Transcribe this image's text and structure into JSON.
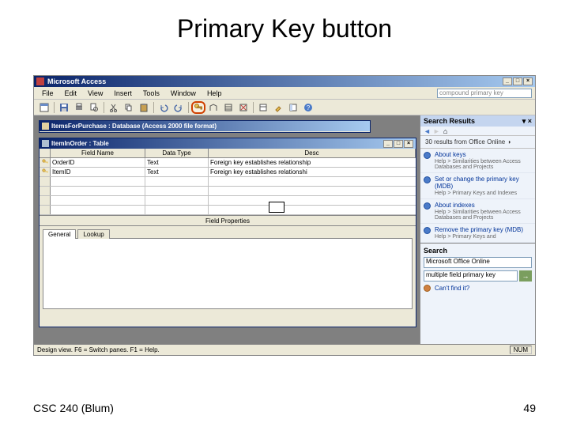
{
  "slide": {
    "title": "Primary Key button",
    "footer_left": "CSC 240 (Blum)",
    "page_number": "49"
  },
  "app": {
    "title": "Microsoft Access",
    "menus": [
      "File",
      "Edit",
      "View",
      "Insert",
      "Tools",
      "Window",
      "Help"
    ],
    "help_search_value": "compound primary key"
  },
  "callout": "Primary Key",
  "db_window_title": "ItemsForPurchase : Database (Access 2000 file format)",
  "table_window_title": "ItemInOrder : Table",
  "design_columns": {
    "field_name": "Field Name",
    "data_type": "Data Type",
    "description": "Desc"
  },
  "design_rows": [
    {
      "key": true,
      "field": "OrderID",
      "type": "Text",
      "desc": "Foreign key establishes relationship"
    },
    {
      "key": true,
      "field": "ItemID",
      "type": "Text",
      "desc": "Foreign key establishes relationshi"
    }
  ],
  "splitter_label": "Field Properties",
  "prop_tabs": {
    "general": "General",
    "lookup": "Lookup"
  },
  "task_pane": {
    "title": "Search Results",
    "source": "30 results from Office Online",
    "items": [
      {
        "title": "About keys",
        "sub": "Help > Similarities between Access Databases and Projects"
      },
      {
        "title": "Set or change the primary key (MDB)",
        "sub": "Help > Primary Keys and Indexes"
      },
      {
        "title": "About indexes",
        "sub": "Help > Similarities between Access Databases and Projects"
      },
      {
        "title": "Remove the primary key (MDB)",
        "sub": "Help > Primary Keys and"
      }
    ],
    "search_label": "Search",
    "search_scope": "Microsoft Office Online",
    "search_value": "multiple field primary key",
    "cant_find": "Can't find it?"
  },
  "statusbar": {
    "left": "Design view.  F6 = Switch panes.  F1 = Help.",
    "num": "NUM"
  }
}
